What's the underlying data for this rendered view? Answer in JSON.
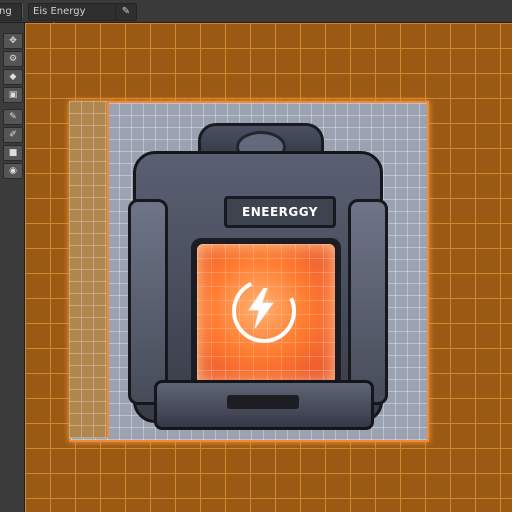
{
  "window": {
    "tab_left": "ng",
    "tab_title": "Eis Energy Canister",
    "tab_icon": "pen-icon"
  },
  "toolbar": {
    "tools": [
      {
        "icon": "move-icon",
        "glyph": "✥"
      },
      {
        "icon": "settings-icon",
        "glyph": "⚙"
      },
      {
        "icon": "link-icon",
        "glyph": "◆"
      },
      {
        "icon": "layer-icon",
        "glyph": "▣"
      },
      {
        "icon": "pencil-icon",
        "glyph": "✎"
      },
      {
        "icon": "brush-icon",
        "glyph": "✐"
      },
      {
        "icon": "square-icon",
        "glyph": "■"
      },
      {
        "icon": "eye-icon",
        "glyph": "◉"
      }
    ]
  },
  "canvas": {
    "device_label": "ENEERGGY",
    "screen_icon": "lightning-bolt-icon",
    "colors": {
      "grid_background": "#9a5a14",
      "grid_lines": "#d2862e",
      "selection_border": "#f08a3a",
      "screen_glow": "#ff7b2f"
    }
  }
}
